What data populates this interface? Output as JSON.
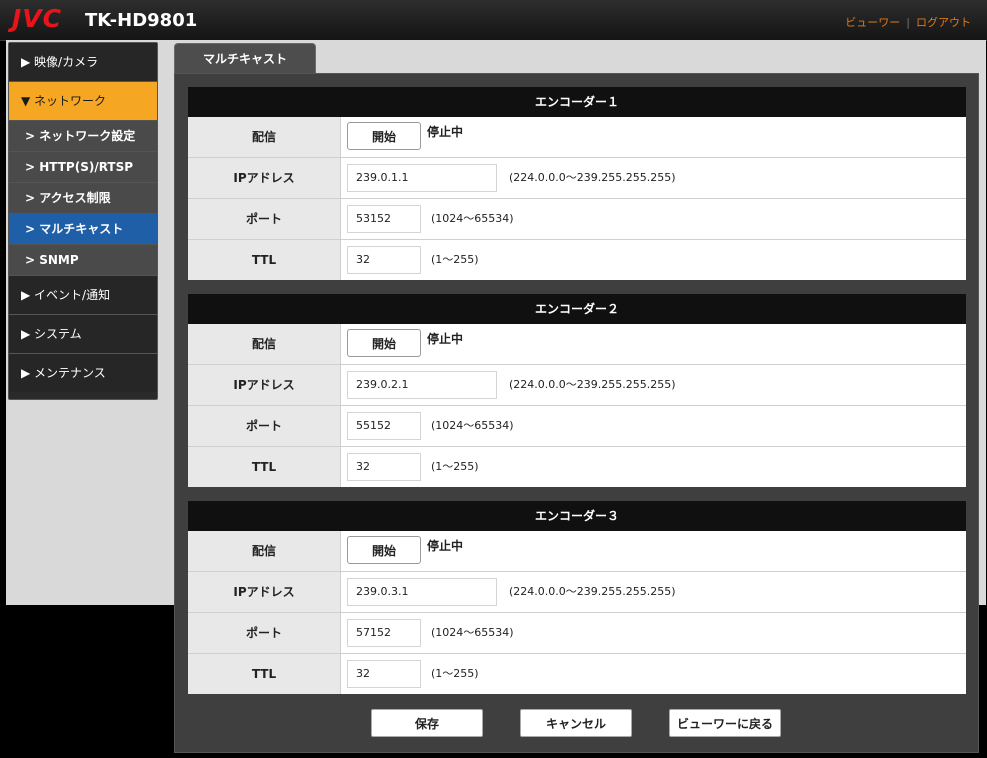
{
  "header": {
    "logo": "JVC",
    "model": "TK-HD9801",
    "viewer_link": "ビューワー",
    "separator": "|",
    "logout_link": "ログアウト"
  },
  "sidebar": {
    "items": [
      {
        "label": "▶ 映像/カメラ"
      },
      {
        "label": "▼ ネットワーク"
      },
      {
        "label": "▶ イベント/通知"
      },
      {
        "label": "▶ システム"
      },
      {
        "label": "▶ メンテナンス"
      }
    ],
    "subitems": [
      {
        "label": "> ネットワーク設定"
      },
      {
        "label": "> HTTP(S)/RTSP"
      },
      {
        "label": "> アクセス制限"
      },
      {
        "label": "> マルチキャスト"
      },
      {
        "label": "> SNMP"
      }
    ]
  },
  "tab": {
    "label": "マルチキャスト"
  },
  "labels": {
    "delivery": "配信",
    "ip": "IPアドレス",
    "port": "ポート",
    "ttl": "TTL",
    "start_button": "開始",
    "status_stopped": "停止中",
    "ip_range": "(224.0.0.0〜239.255.255.255)",
    "port_range": "(1024〜65534)",
    "ttl_range": "(1〜255)"
  },
  "encoders": [
    {
      "title": "エンコーダー１",
      "ip": "239.0.1.1",
      "port": "53152",
      "ttl": "32"
    },
    {
      "title": "エンコーダー２",
      "ip": "239.0.2.1",
      "port": "55152",
      "ttl": "32"
    },
    {
      "title": "エンコーダー３",
      "ip": "239.0.3.1",
      "port": "57152",
      "ttl": "32"
    }
  ],
  "actions": {
    "save": "保存",
    "cancel": "キャンセル",
    "back": "ビューワーに戻る"
  },
  "colors": {
    "brand_red": "#e8141b",
    "accent_orange": "#f5a623",
    "selected_blue": "#1e5fa8",
    "link_orange": "#e07a1a"
  }
}
